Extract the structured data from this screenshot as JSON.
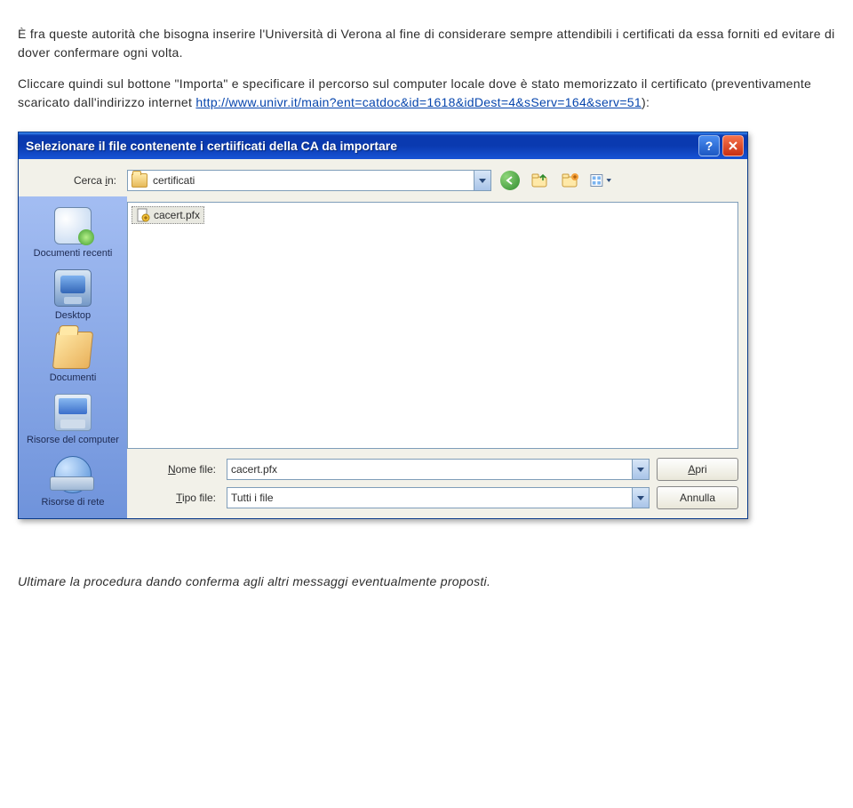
{
  "doc": {
    "p1": "È fra queste autorità che bisogna inserire l'Università di Verona al fine di considerare sempre attendibili i certificati da essa forniti ed evitare di dover confermare ogni volta.",
    "p2a": "Cliccare quindi sul bottone \"Importa\" e specificare il percorso sul computer locale dove è stato memorizzato il certificato (preventivamente scaricato dall'indirizzo internet ",
    "link": "http://www.univr.it/main?ent=catdoc&id=1618&idDest=4&sServ=164&serv=51",
    "p2b": "):",
    "footer": "Ultimare la procedura dando conferma agli altri messaggi eventualmente proposti."
  },
  "dialog": {
    "title": "Selezionare il file contenente i certiificati della CA da importare",
    "lookin_label": "Cerca in:",
    "lookin_folder": "certificati",
    "filename_label": "Nome file:",
    "filename_value": "cacert.pfx",
    "filetype_label": "Tipo file:",
    "filetype_value": "Tutti i file",
    "open_btn": "Apri",
    "cancel_btn": "Annulla",
    "file_list": {
      "item0": "cacert.pfx"
    },
    "places": {
      "recent": "Documenti recenti",
      "desktop": "Desktop",
      "docs": "Documenti",
      "computer": "Risorse del computer",
      "network": "Risorse di rete"
    }
  }
}
